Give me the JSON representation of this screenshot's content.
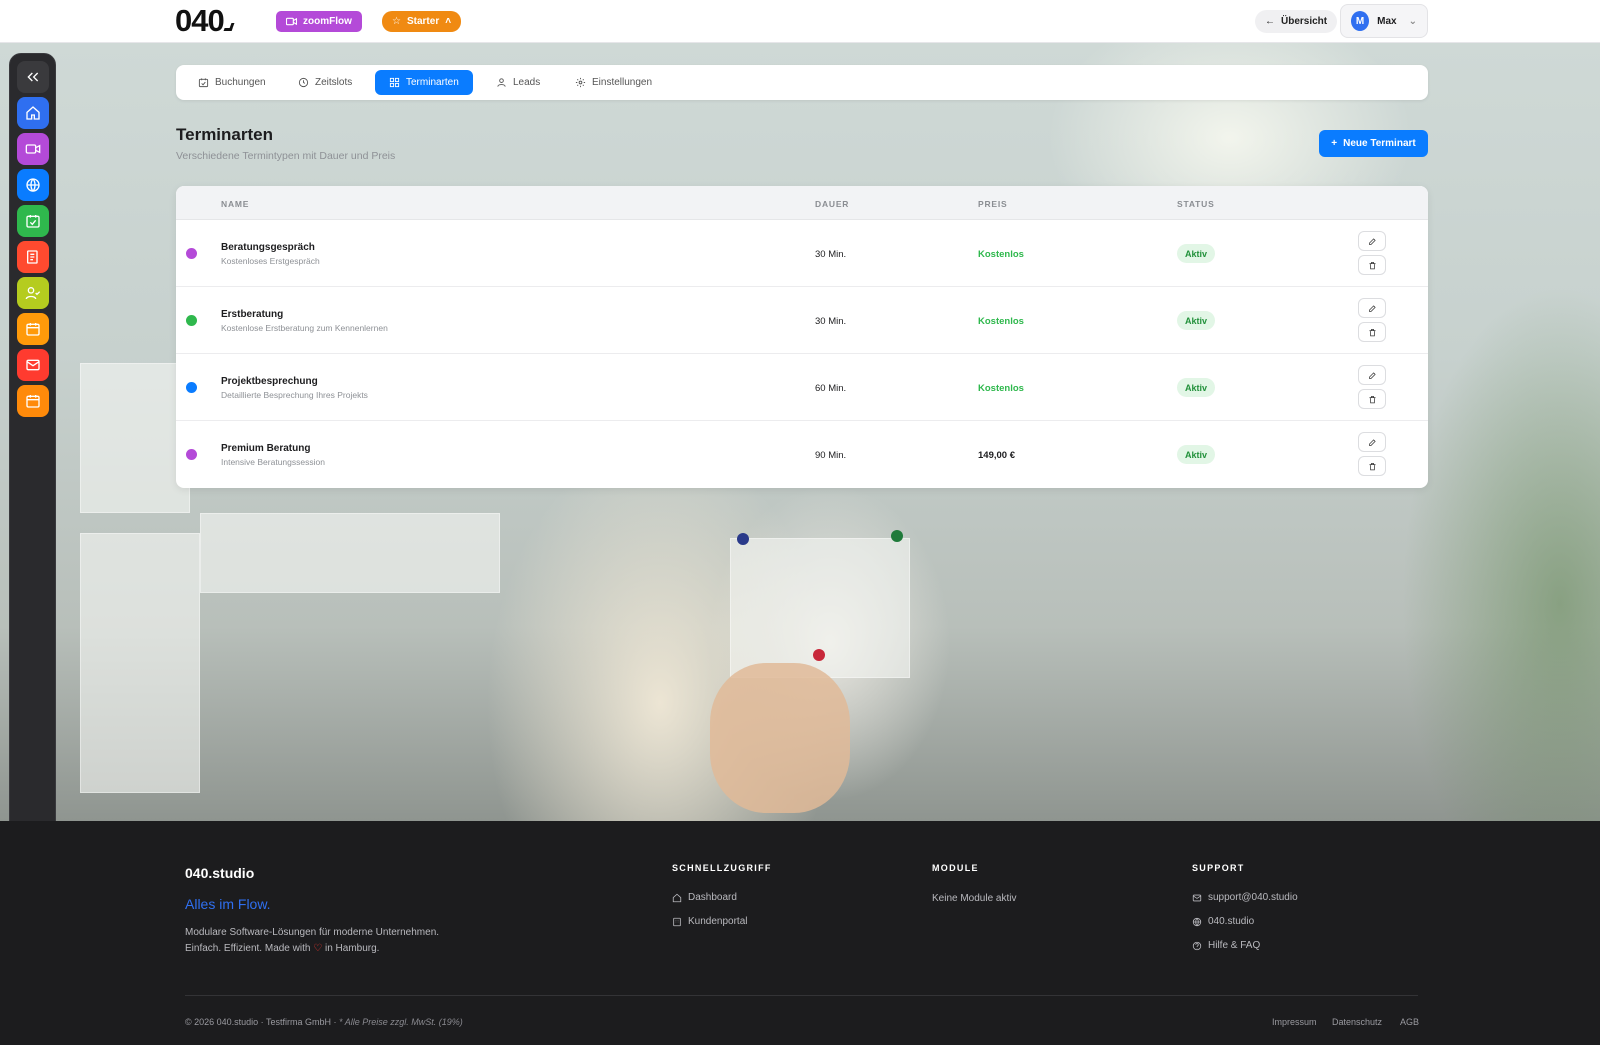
{
  "header": {
    "logo": "040",
    "app_badge": "zoomFlow",
    "plan_badge": "Starter",
    "overview_button": "Übersicht",
    "user": {
      "initial": "M",
      "name": "Max"
    }
  },
  "sidebar": {
    "items": [
      {
        "name": "collapse",
        "icon": "double-chevron-left-icon",
        "color": "#3a3a3d"
      },
      {
        "name": "home",
        "icon": "home-icon",
        "color": "#2f6ff0"
      },
      {
        "name": "zoomflow",
        "icon": "video-icon",
        "color": "#b44ad8"
      },
      {
        "name": "web",
        "icon": "globe-icon",
        "color": "#0a7cff"
      },
      {
        "name": "calendar-check",
        "icon": "calendar-check-icon",
        "color": "#2fb84d"
      },
      {
        "name": "invoices",
        "icon": "receipt-icon",
        "color": "#ff4a2f"
      },
      {
        "name": "contacts",
        "icon": "user-check-icon",
        "color": "#b5cc1f"
      },
      {
        "name": "calendar",
        "icon": "calendar-icon",
        "color": "#ff9a0a"
      },
      {
        "name": "mail",
        "icon": "mail-icon",
        "color": "#ff3b2f"
      },
      {
        "name": "schedule",
        "icon": "calendar-icon",
        "color": "#ff8a0a"
      },
      {
        "name": "help",
        "icon": "help-circle-icon",
        "color": "#8a4fe0"
      },
      {
        "name": "add",
        "icon": "plus-icon",
        "color": "#2fb84d"
      },
      {
        "name": "settings",
        "icon": "gear-icon",
        "color": "#2f6ff0"
      }
    ]
  },
  "tabs": [
    {
      "label": "Buchungen",
      "icon": "calendar-check-icon",
      "active": false
    },
    {
      "label": "Zeitslots",
      "icon": "clock-icon",
      "active": false
    },
    {
      "label": "Terminarten",
      "icon": "grid-icon",
      "active": true
    },
    {
      "label": "Leads",
      "icon": "user-icon",
      "active": false
    },
    {
      "label": "Einstellungen",
      "icon": "gear-icon",
      "active": false
    }
  ],
  "page": {
    "title": "Terminarten",
    "subtitle": "Verschiedene Termintypen mit Dauer und Preis",
    "new_button": "Neue Terminart"
  },
  "table": {
    "columns": [
      "NAME",
      "DAUER",
      "PREIS",
      "STATUS"
    ],
    "rows": [
      {
        "color": "#b44ad8",
        "name": "Beratungsgespräch",
        "description": "Kostenloses Erstgespräch",
        "duration": "30 Min.",
        "price": "Kostenlos",
        "price_color": "#2fb84d",
        "status": "Aktiv"
      },
      {
        "color": "#2fb84d",
        "name": "Erstberatung",
        "description": "Kostenlose Erstberatung zum Kennenlernen",
        "duration": "30 Min.",
        "price": "Kostenlos",
        "price_color": "#2fb84d",
        "status": "Aktiv"
      },
      {
        "color": "#0a7cff",
        "name": "Projektbesprechung",
        "description": "Detaillierte Besprechung Ihres Projekts",
        "duration": "60 Min.",
        "price": "Kostenlos",
        "price_color": "#2fb84d",
        "status": "Aktiv"
      },
      {
        "color": "#b44ad8",
        "name": "Premium Beratung",
        "description": "Intensive Beratungssession",
        "duration": "90 Min.",
        "price": "149,00 €",
        "price_color": "#1d1d1f",
        "status": "Aktiv"
      }
    ]
  },
  "footer": {
    "brand": "040.studio",
    "tagline": "Alles im Flow.",
    "desc_line1": "Modulare Software-Lösungen für moderne Unternehmen.",
    "desc_line2_before": "Einfach. Effizient. Made with",
    "desc_line2_after": "in Hamburg.",
    "quick_heading": "SCHNELLZUGRIFF",
    "quick_links": [
      "Dashboard",
      "Kundenportal"
    ],
    "modules_heading": "MODULE",
    "modules_text": "Keine Module aktiv",
    "support_heading": "SUPPORT",
    "support_links": [
      "support@040.studio",
      "040.studio",
      "Hilfe & FAQ"
    ],
    "copyright": "© 2026 040.studio · Testfirma GmbH ·",
    "vat_note": "* Alle Preise zzgl. MwSt. (19%)",
    "legal_links": [
      "Impressum",
      "Datenschutz",
      "AGB"
    ]
  }
}
